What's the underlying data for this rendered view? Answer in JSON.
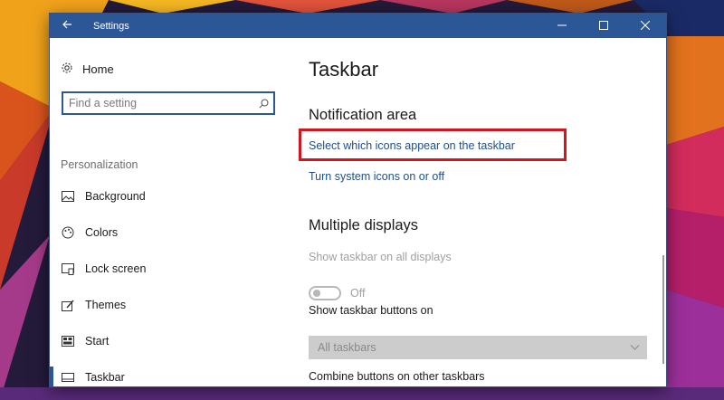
{
  "window": {
    "title": "Settings"
  },
  "sidebar": {
    "home_label": "Home",
    "search_placeholder": "Find a setting",
    "section_label": "Personalization",
    "items": [
      {
        "label": "Background",
        "icon": "picture-icon"
      },
      {
        "label": "Colors",
        "icon": "palette-icon"
      },
      {
        "label": "Lock screen",
        "icon": "lock-screen-icon"
      },
      {
        "label": "Themes",
        "icon": "themes-icon"
      },
      {
        "label": "Start",
        "icon": "start-icon"
      },
      {
        "label": "Taskbar",
        "icon": "taskbar-icon",
        "active": true
      }
    ]
  },
  "main": {
    "page_title": "Taskbar",
    "notification_area": {
      "heading": "Notification area",
      "link_select_icons": "Select which icons appear on the taskbar",
      "link_system_icons": "Turn system icons on or off"
    },
    "multiple_displays": {
      "heading": "Multiple displays",
      "show_all_label": "Show taskbar all displays",
      "show_all_label_full": "Show taskbar on all displays",
      "toggle_state": "Off",
      "buttons_on_label": "Show taskbar buttons on",
      "buttons_on_value": "All taskbars",
      "combine_label": "Combine buttons on other taskbars"
    }
  },
  "colors": {
    "accent": "#2b5797",
    "highlight_border": "#d3151d",
    "link": "#1f4e8c"
  }
}
